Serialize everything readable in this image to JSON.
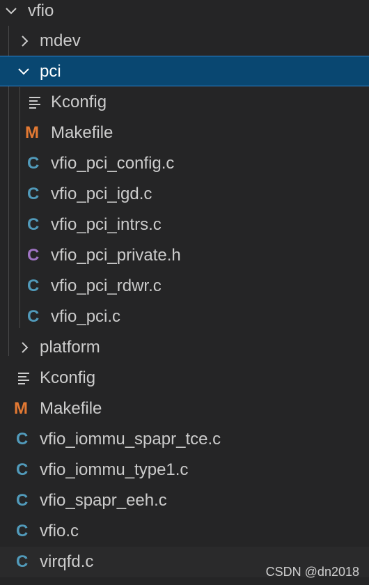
{
  "explorer": {
    "root_folder": "vfio",
    "folder_mdev": "mdev",
    "folder_pci": "pci",
    "pci_files": [
      "Kconfig",
      "Makefile",
      "vfio_pci_config.c",
      "vfio_pci_igd.c",
      "vfio_pci_intrs.c",
      "vfio_pci_private.h",
      "vfio_pci_rdwr.c",
      "vfio_pci.c"
    ],
    "folder_platform": "platform",
    "root_files": [
      "Kconfig",
      "Makefile",
      "vfio_iommu_spapr_tce.c",
      "vfio_iommu_type1.c",
      "vfio_spapr_eeh.c",
      "vfio.c",
      "virqfd.c"
    ]
  },
  "watermark": "CSDN @dn2018",
  "icon_glyphs": {
    "c_file": "C",
    "makefile": "M"
  },
  "colors": {
    "c_file_icon": "#519aba",
    "header_file_icon": "#a074c4",
    "makefile_icon": "#e37933",
    "selection_bg": "#094771",
    "selection_border": "#2f86d2"
  }
}
